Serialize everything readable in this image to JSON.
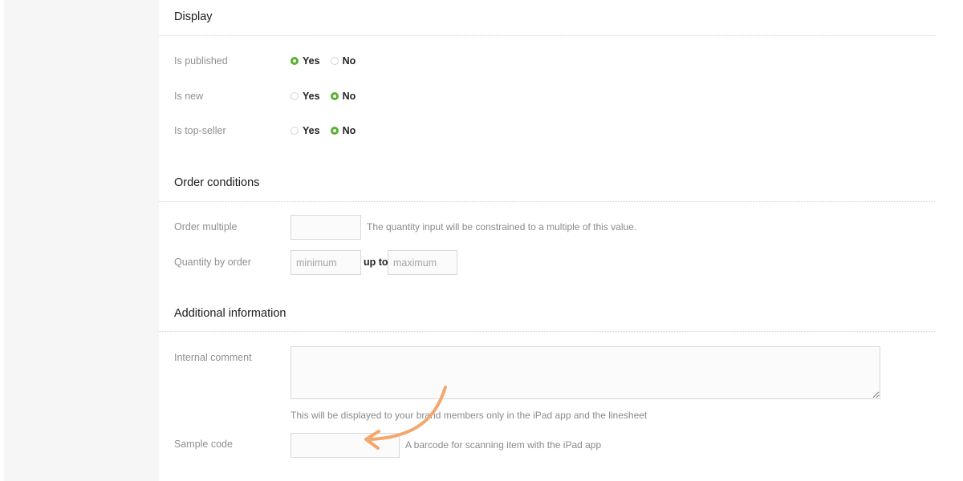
{
  "sections": {
    "display": {
      "title": "Display",
      "rows": [
        {
          "label": "Is published",
          "yes": "Yes",
          "no": "No",
          "selected": "yes"
        },
        {
          "label": "Is new",
          "yes": "Yes",
          "no": "No",
          "selected": "no"
        },
        {
          "label": "Is top-seller",
          "yes": "Yes",
          "no": "No",
          "selected": "no"
        }
      ]
    },
    "order_conditions": {
      "title": "Order conditions",
      "order_multiple": {
        "label": "Order multiple",
        "value": "",
        "help": "The quantity input will be constrained to a multiple of this value."
      },
      "quantity_by_order": {
        "label": "Quantity by order",
        "min_placeholder": "minimum",
        "up_to": "up to",
        "max_placeholder": "maximum"
      }
    },
    "additional_information": {
      "title": "Additional information",
      "internal_comment": {
        "label": "Internal comment",
        "value": "",
        "help": "This will be displayed to your brand members only in the iPad app and the linesheet"
      },
      "sample_code": {
        "label": "Sample code",
        "value": "",
        "help": "A barcode for scanning item with the iPad app"
      }
    }
  },
  "colors": {
    "radio_selected": "#5ab031",
    "annotation_arrow": "#f4a66e",
    "left_rail": "#f6f6f6"
  },
  "annotation": {
    "icon": "curved-arrow-icon"
  }
}
